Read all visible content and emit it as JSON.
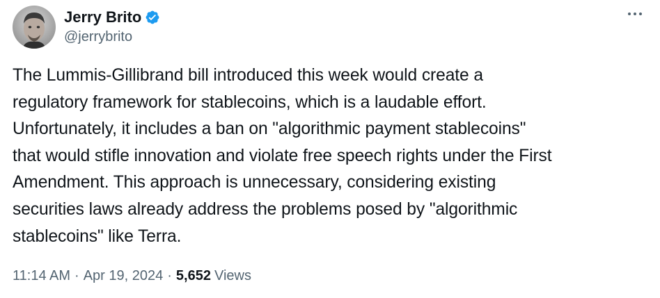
{
  "author": {
    "display_name": "Jerry Brito",
    "handle": "@jerrybrito",
    "verified_icon": "verified-badge-icon"
  },
  "menu": {
    "more_icon": "more-horizontal-icon"
  },
  "tweet": {
    "lines": [
      "The Lummis-Gillibrand bill introduced this week would create a",
      "regulatory framework for stablecoins, which is a laudable effort.",
      "Unfortunately, it includes a ban on \"algorithmic payment stablecoins\"",
      "that would stifle innovation and violate free speech rights under the First",
      "Amendment. This approach is unnecessary, considering existing",
      "securities laws already address the problems posed by \"algorithmic",
      "stablecoins\" like Terra."
    ]
  },
  "meta": {
    "time": "11:14 AM",
    "separator": "·",
    "date": "Apr 19, 2024",
    "views_count": "5,652",
    "views_label": "Views"
  },
  "colors": {
    "text_primary": "#0f1419",
    "text_secondary": "#536471",
    "verified_blue": "#1d9bf0",
    "background": "#ffffff"
  }
}
